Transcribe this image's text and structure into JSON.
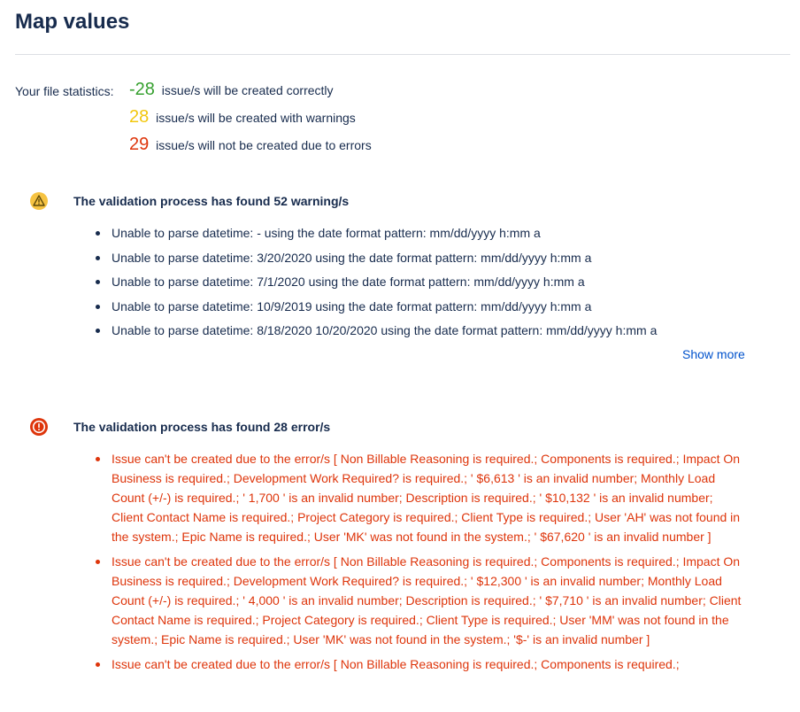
{
  "page": {
    "title": "Map values"
  },
  "stats": {
    "label": "Your file statistics:",
    "correct": {
      "count": "-28",
      "text": "issue/s will be created correctly"
    },
    "warnings": {
      "count": "28",
      "text": "issue/s will be created with warnings"
    },
    "errors": {
      "count": "29",
      "text": "issue/s will not be created due to errors"
    }
  },
  "warnings": {
    "icon": "warning-triangle-icon",
    "title": "The validation process has found 52 warning/s",
    "items": [
      "Unable to parse datetime: - using the date format pattern: mm/dd/yyyy h:mm a",
      "Unable to parse datetime: 3/20/2020 using the date format pattern: mm/dd/yyyy h:mm a",
      "Unable to parse datetime: 7/1/2020 using the date format pattern: mm/dd/yyyy h:mm a",
      "Unable to parse datetime: 10/9/2019 using the date format pattern: mm/dd/yyyy h:mm a",
      "Unable to parse datetime: 8/18/2020 10/20/2020 using the date format pattern: mm/dd/yyyy h:mm a"
    ],
    "show_more": "Show more"
  },
  "errors": {
    "icon": "error-circle-icon",
    "title": "The validation process has found 28 error/s",
    "items": [
      "Issue can't be created due to the error/s [ Non Billable Reasoning is required.; Components is required.; Impact On Business is required.; Development Work Required? is required.; ' $6,613 ' is an invalid number; Monthly Load Count (+/-) is required.; ' 1,700 ' is an invalid number; Description is required.; ' $10,132 ' is an invalid number; Client Contact Name is required.; Project Category is required.; Client Type is required.; User 'AH' was not found in the system.; Epic Name is required.; User 'MK' was not found in the system.; ' $67,620 ' is an invalid number ]",
      "Issue can't be created due to the error/s [ Non Billable Reasoning is required.; Components is required.; Impact On Business is required.; Development Work Required? is required.; ' $12,300 ' is an invalid number; Monthly Load Count (+/-) is required.; ' 4,000 ' is an invalid number; Description is required.; ' $7,710 ' is an invalid number; Client Contact Name is required.; Project Category is required.; Client Type is required.; User 'MM' was not found in the system.; Epic Name is required.; User 'MK' was not found in the system.; '$-' is an invalid number ]",
      "Issue can't be created due to the error/s [ Non Billable Reasoning is required.; Components is required.;"
    ]
  },
  "colors": {
    "correct": "#36a02f",
    "warning": "#f2c70e",
    "error": "#de350b",
    "link": "#0052cc",
    "text": "#172b4d"
  }
}
